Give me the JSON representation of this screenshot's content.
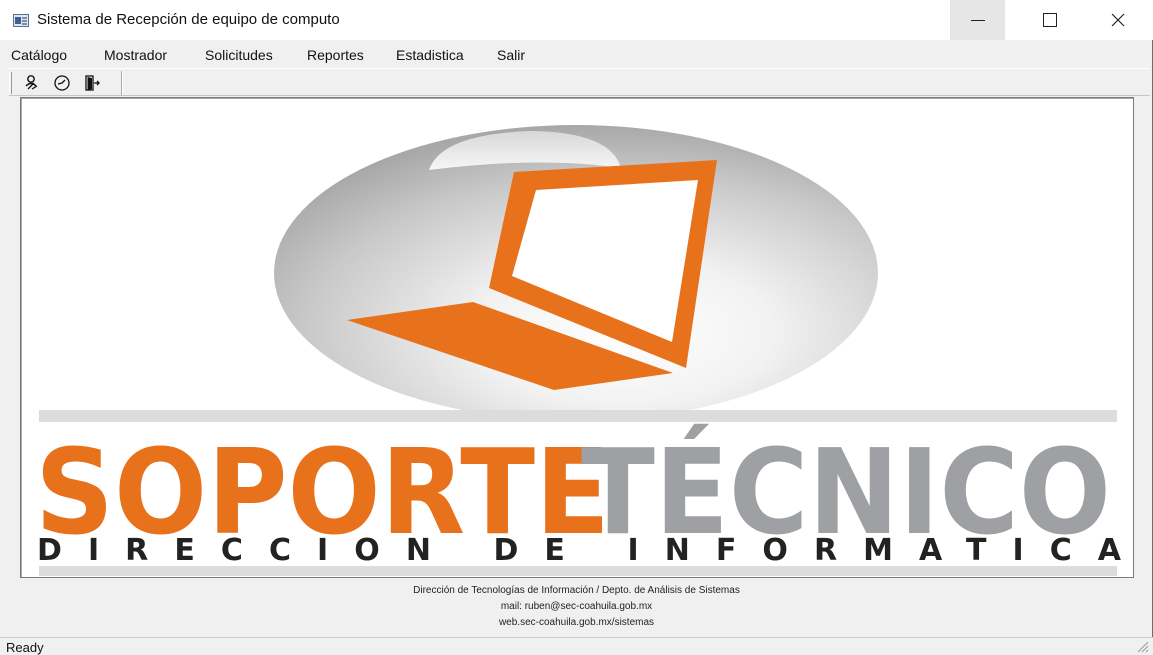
{
  "window": {
    "title": "Sistema de Recepción de equipo de computo"
  },
  "controls": {
    "minimize_label": "—",
    "maximize_label": "☐",
    "close_label": "✕"
  },
  "menu": {
    "items": [
      {
        "label": "Catálogo"
      },
      {
        "label": "Mostrador"
      },
      {
        "label": "Solicitudes"
      },
      {
        "label": "Reportes"
      },
      {
        "label": "Estadistica"
      },
      {
        "label": "Salir"
      }
    ]
  },
  "toolbar": {
    "buttons": [
      {
        "icon": "user-search-icon"
      },
      {
        "icon": "clock-icon"
      },
      {
        "icon": "exit-door-icon"
      }
    ]
  },
  "logo": {
    "word1": "SOPORTE",
    "word2": "TÉCNICO",
    "subtitle": "DIRECCION DE INFORMATICA",
    "colors": {
      "orange": "#e8711c",
      "gray": "#9ea0a3",
      "dark": "#222222"
    }
  },
  "footer": {
    "line1": "Dirección de Tecnologías de Información / Depto. de Análisis de Sistemas",
    "line2": "mail: ruben@sec-coahuila.gob.mx",
    "line3": "web.sec-coahuila.gob.mx/sistemas"
  },
  "status": {
    "text": "Ready"
  }
}
